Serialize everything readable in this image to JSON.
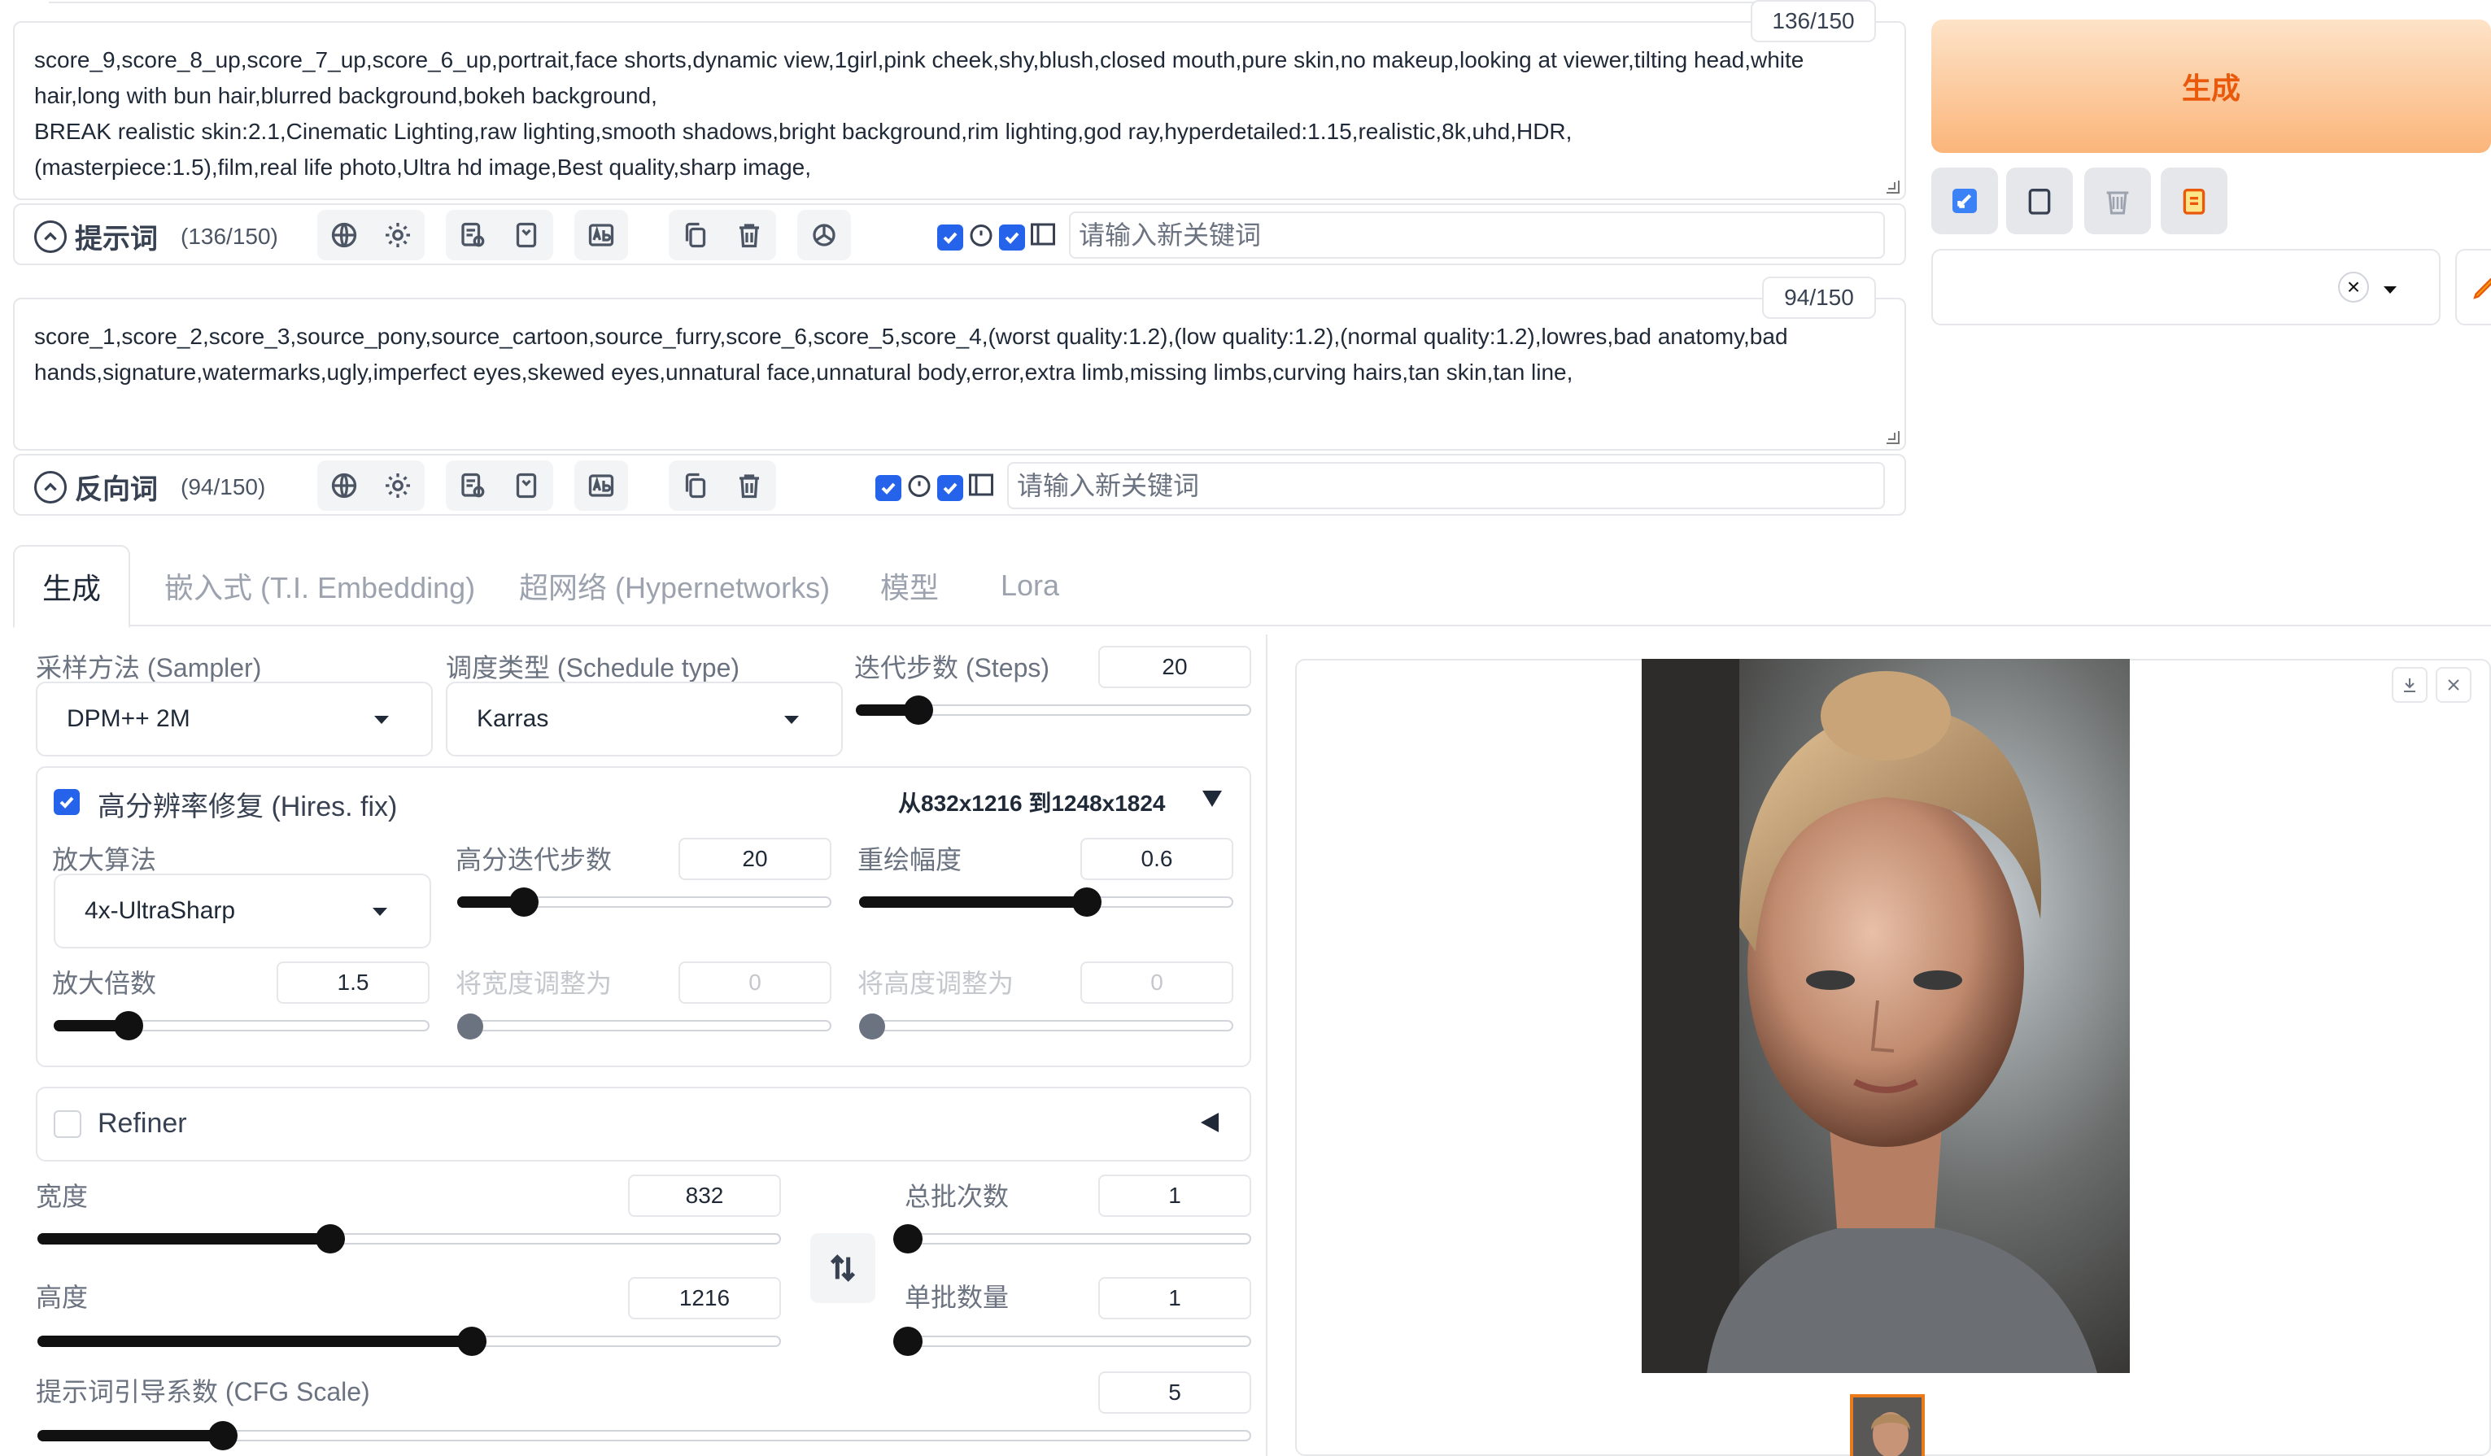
{
  "prompt": {
    "text": "score_9,score_8_up,score_7_up,score_6_up,portrait,face shorts,dynamic view,1girl,pink cheek,shy,blush,closed mouth,pure skin,no makeup,looking at viewer,tilting head,white  hair,long with bun hair,blurred background,bokeh background,\nBREAK realistic skin:2.1,Cinematic Lighting,raw lighting,smooth shadows,bright background,rim lighting,god ray,hyperdetailed:1.15,realistic,8k,uhd,HDR,\n(masterpiece:1.5),film,real life photo,Ultra hd image,Best quality,sharp image,",
    "counter": "136/150",
    "title": "提示词",
    "count_label": "(136/150)",
    "new_keyword_placeholder": "请输入新关键词"
  },
  "negative": {
    "text": "score_1,score_2,score_3,source_pony,source_cartoon,source_furry,score_6,score_5,score_4,(worst quality:1.2),(low quality:1.2),(normal quality:1.2),lowres,bad anatomy,bad hands,signature,watermarks,ugly,imperfect eyes,skewed eyes,unnatural face,unnatural body,error,extra limb,missing limbs,curving hairs,tan skin,tan line,",
    "counter": "94/150",
    "title": "反向词",
    "count_label": "(94/150)",
    "new_keyword_placeholder": "请输入新关键词"
  },
  "generate_label": "生成",
  "style_close": "×",
  "tabs": [
    "生成",
    "嵌入式 (T.I. Embedding)",
    "超网络 (Hypernetworks)",
    "模型",
    "Lora"
  ],
  "sampler": {
    "label": "采样方法 (Sampler)",
    "value": "DPM++ 2M"
  },
  "schedule": {
    "label": "调度类型 (Schedule type)",
    "value": "Karras"
  },
  "steps": {
    "label": "迭代步数 (Steps)",
    "value": "20",
    "fraction": 0.15
  },
  "hires": {
    "label": "高分辨率修复 (Hires. fix)",
    "summary": "从832x1216 到1248x1824",
    "upscaler": {
      "label": "放大算法",
      "value": "4x-UltraSharp"
    },
    "hires_steps": {
      "label": "高分迭代步数",
      "value": "20",
      "fraction": 0.17
    },
    "denoise": {
      "label": "重绘幅度",
      "value": "0.6",
      "fraction": 0.6
    },
    "scale": {
      "label": "放大倍数",
      "value": "1.5",
      "fraction": 0.19
    },
    "resize_w": {
      "label": "将宽度调整为",
      "value": "0"
    },
    "resize_h": {
      "label": "将高度调整为",
      "value": "0"
    }
  },
  "refiner": {
    "label": "Refiner"
  },
  "width": {
    "label": "宽度",
    "value": "832",
    "fraction": 0.39
  },
  "height": {
    "label": "高度",
    "value": "1216",
    "fraction": 0.58
  },
  "batch_count": {
    "label": "总批次数",
    "value": "1",
    "fraction": 0.0
  },
  "batch_size": {
    "label": "单批数量",
    "value": "1",
    "fraction": 0.0
  },
  "cfg": {
    "label": "提示词引导系数 (CFG Scale)",
    "value": "5",
    "fraction": 0.15
  },
  "colors": {
    "accent": "#2563eb",
    "generate": "#ea580c"
  }
}
